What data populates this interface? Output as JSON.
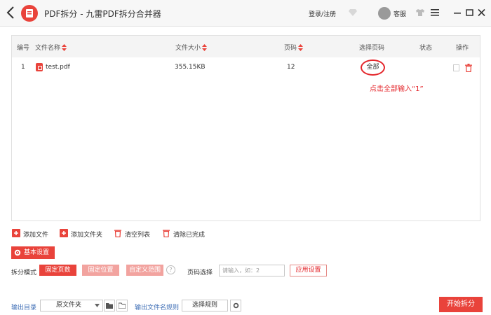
{
  "window": {
    "title": "PDF拆分 - 九雷PDF拆分合并器",
    "login_label": "登录/注册",
    "service_label": "客服"
  },
  "colors": {
    "accent": "#e9433b",
    "annotation": "#e4262b",
    "link": "#3d6db5"
  },
  "table": {
    "headers": [
      "编号",
      "文件名称",
      "文件大小",
      "页码",
      "选择页码",
      "状态",
      "操作"
    ],
    "rows": [
      {
        "index": "1",
        "name": "test.pdf",
        "size": "355.15KB",
        "pages": "12",
        "select": "全部",
        "status": ""
      }
    ]
  },
  "annotation": "点击全部输入“1”",
  "actions": {
    "add_file": "添加文件",
    "add_folder": "添加文件夹",
    "clear_list": "清空列表",
    "clear_done": "清除已完成"
  },
  "settings": {
    "basic_label": "基本设置",
    "mode_label": "拆分模式",
    "modes": [
      "固定页数",
      "固定位置",
      "自定义范围"
    ],
    "selected_mode": "固定页数",
    "page_select_label": "页码选择",
    "page_input_placeholder": "请输入，如：2",
    "apply_label": "应用设置"
  },
  "output": {
    "dir_label": "输出目录",
    "dir_value": "原文件夹",
    "rule_label": "输出文件名规则",
    "rule_button": "选择规则"
  },
  "start_label": "开始拆分",
  "icons": [
    "back-icon",
    "logo-icon",
    "diamond-icon",
    "avatar",
    "shirt-icon",
    "menu-icon",
    "minimize-icon",
    "maximize-icon",
    "close-icon",
    "sort-icon",
    "pdf-icon",
    "document-icon",
    "trash-icon",
    "add-file-icon",
    "add-folder-icon",
    "clear-list-icon",
    "clear-done-icon",
    "gear-icon",
    "help-icon",
    "folder-icon",
    "open-folder-icon"
  ]
}
